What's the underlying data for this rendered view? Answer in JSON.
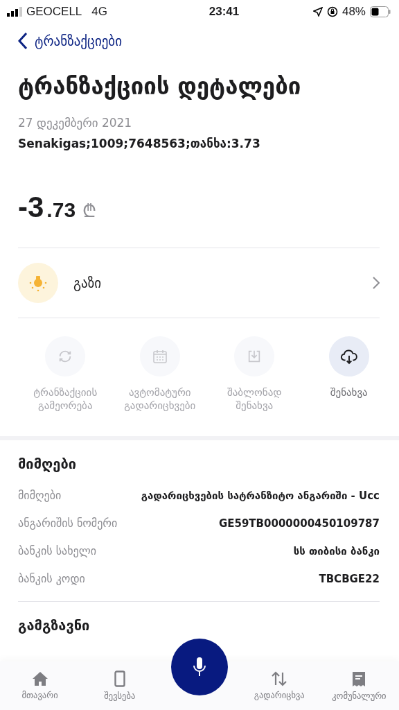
{
  "status_bar": {
    "carrier": "GEOCELL",
    "network": "4G",
    "time": "23:41",
    "battery": "48%"
  },
  "back": {
    "label": "ტრანზაქციები"
  },
  "title": "ტრანზაქციის დეტალები",
  "date": "27 დეკემბერი 2021",
  "description": "Senakigas;1009;7648563;თანხა:3.73",
  "amount": {
    "main": "-3",
    "decimals": ".73",
    "currency": "₾"
  },
  "category": {
    "label": "გაზი"
  },
  "actions": [
    {
      "kind": "repeat",
      "label": "ტრანზაქციის გამეორება",
      "disabled": true
    },
    {
      "kind": "calendar",
      "label": "ავტომატური გადარიცხვები",
      "disabled": true
    },
    {
      "kind": "template",
      "label": "შაბლონად შენახვა",
      "disabled": true
    },
    {
      "kind": "save",
      "label": "შენახვა",
      "disabled": false
    }
  ],
  "recipient": {
    "heading": "მიმღები",
    "rows": [
      {
        "label": "მიმღები",
        "value": "გადარიცხვების სატრანზიტო ანგარიში - Ucc"
      },
      {
        "label": "ანგარიშის ნომერი",
        "value": "GE59TB0000000450109787"
      },
      {
        "label": "ბანკის სახელი",
        "value": "სს თიბისი ბანკი"
      },
      {
        "label": "ბანკის კოდი",
        "value": "TBCBGE22"
      }
    ]
  },
  "sender": {
    "heading": "გამგზავნი"
  },
  "bottom_nav": [
    {
      "kind": "home",
      "label": "მთავარი"
    },
    {
      "kind": "phone",
      "label": "შევსება"
    },
    {
      "kind": "mic"
    },
    {
      "kind": "transfer",
      "label": "გადარიცხვა"
    },
    {
      "kind": "bill",
      "label": "კომუნალური"
    }
  ]
}
